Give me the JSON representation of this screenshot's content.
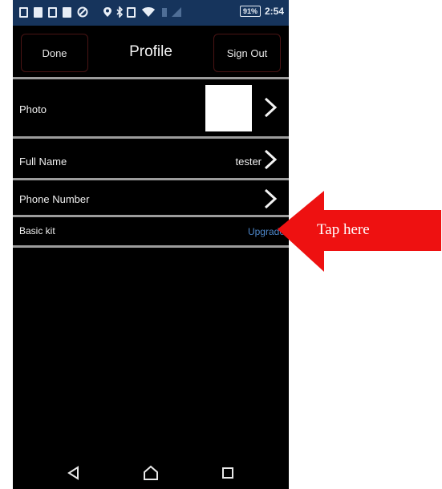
{
  "status_bar": {
    "battery": "91%",
    "time": "2:54"
  },
  "header": {
    "done_label": "Done",
    "title": "Profile",
    "sign_out_label": "Sign Out"
  },
  "rows": {
    "photo": {
      "label": "Photo"
    },
    "full_name": {
      "label": "Full Name",
      "value": "tester"
    },
    "phone_number": {
      "label": "Phone Number"
    },
    "basic_kit": {
      "label": "Basic kit",
      "action": "Upgrade"
    }
  },
  "callout": {
    "text": "Tap here",
    "color": "#ee1111"
  },
  "colors": {
    "status_bar_bg": "#16345c",
    "screen_bg": "#000000",
    "divider": "#9c9c9c",
    "link": "#4d86c8",
    "button_border": "#4a1414"
  },
  "icons": [
    "back-triangle-icon",
    "home-icon",
    "recents-square-icon",
    "chevron-right-icon"
  ]
}
